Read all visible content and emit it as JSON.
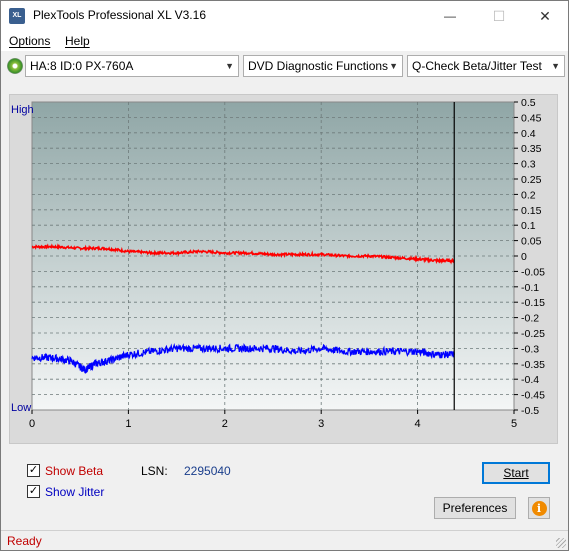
{
  "window": {
    "title": "PlexTools Professional XL V3.16",
    "icon_text": "XL",
    "minimize_glyph": "—",
    "maximize_glyph": "☐",
    "close_glyph": "✕"
  },
  "menu": {
    "items": [
      {
        "label": "Options",
        "mnemonic": "O"
      },
      {
        "label": "Help",
        "mnemonic": "H"
      }
    ]
  },
  "toolbar": {
    "drive": "HA:8 ID:0  PX-760A",
    "function": "DVD Diagnostic Functions",
    "test": "Q-Check Beta/Jitter Test",
    "dropdown_glyph": "▼"
  },
  "chart_data": {
    "type": "line",
    "left_axis_labels": {
      "top": "High",
      "bottom": "Low"
    },
    "x_ticks": [
      0,
      1,
      2,
      3,
      4,
      5
    ],
    "xlim": [
      0,
      5
    ],
    "y_ticks": [
      0.5,
      0.45,
      0.4,
      0.35,
      0.3,
      0.25,
      0.2,
      0.15,
      0.1,
      0.05,
      0,
      -0.05,
      -0.1,
      -0.15,
      -0.2,
      -0.25,
      -0.3,
      -0.35,
      -0.4,
      -0.45,
      -0.5
    ],
    "ylim": [
      -0.5,
      0.5
    ],
    "end_marker_x": 4.38,
    "grid": true,
    "series": [
      {
        "name": "Beta",
        "color": "#ff0000",
        "x": [
          0,
          0.25,
          0.5,
          0.75,
          1.0,
          1.25,
          1.5,
          1.75,
          2.0,
          2.25,
          2.5,
          2.75,
          3.0,
          3.25,
          3.5,
          3.75,
          4.0,
          4.2,
          4.38
        ],
        "y": [
          0.03,
          0.03,
          0.025,
          0.025,
          0.015,
          0.01,
          0.01,
          0.015,
          0.01,
          0.01,
          0.005,
          0.005,
          0.005,
          0.0,
          0.0,
          -0.005,
          -0.01,
          -0.015,
          -0.015
        ]
      },
      {
        "name": "Jitter",
        "color": "#0000ff",
        "x": [
          0,
          0.2,
          0.4,
          0.55,
          0.65,
          0.8,
          1.0,
          1.25,
          1.5,
          1.75,
          2.0,
          2.25,
          2.5,
          2.75,
          3.0,
          3.25,
          3.5,
          3.75,
          4.0,
          4.2,
          4.38
        ],
        "y": [
          -0.33,
          -0.33,
          -0.34,
          -0.37,
          -0.35,
          -0.34,
          -0.32,
          -0.31,
          -0.3,
          -0.3,
          -0.3,
          -0.3,
          -0.3,
          -0.31,
          -0.3,
          -0.31,
          -0.31,
          -0.31,
          -0.31,
          -0.32,
          -0.32
        ]
      }
    ]
  },
  "bottom": {
    "show_beta": {
      "label": "Show Beta",
      "checked": true,
      "color": "#c00000"
    },
    "show_jitter": {
      "label": "Show Jitter",
      "checked": true,
      "color": "#0000c0"
    },
    "lsn_label": "LSN:",
    "lsn_value": "2295040",
    "start_label": "Start",
    "preferences_label": "Preferences",
    "info_glyph": "i"
  },
  "status": {
    "text": "Ready"
  }
}
